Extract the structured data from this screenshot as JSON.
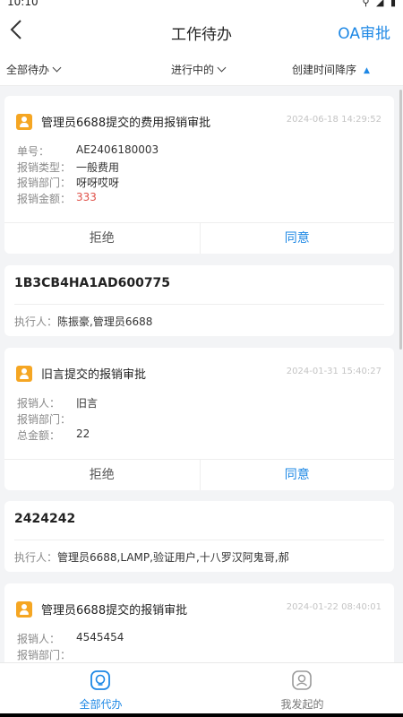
{
  "status_bar": {
    "time": "10:10"
  },
  "header": {
    "title": "工作待办",
    "action": "OA审批"
  },
  "filters": {
    "scope": "全部待办",
    "state": "进行中的",
    "sort": "创建时间降序"
  },
  "approvals": [
    {
      "title": "管理员6688提交的费用报销审批",
      "time": "2024-06-18 14:29:52",
      "fields": [
        {
          "label": "单号：",
          "value": "AE2406180003"
        },
        {
          "label": "报销类型：",
          "value": "一般费用"
        },
        {
          "label": "报销部门：",
          "value": "呀呀哎呀"
        },
        {
          "label": "报销金额：",
          "value": "333",
          "highlight": "#e0524a"
        }
      ],
      "reject_label": "拒绝",
      "approve_label": "同意"
    },
    {
      "title": "旧言提交的报销审批",
      "time": "2024-01-31 15:40:27",
      "fields": [
        {
          "label": "报销人：",
          "value": "旧言"
        },
        {
          "label": "报销部门：",
          "value": ""
        },
        {
          "label": "总金额：",
          "value": "22"
        }
      ],
      "reject_label": "拒绝",
      "approve_label": "同意"
    },
    {
      "title": "管理员6688提交的报销审批",
      "time": "2024-01-22 08:40:01",
      "fields": [
        {
          "label": "报销人：",
          "value": "4545454"
        },
        {
          "label": "报销部门：",
          "value": ""
        }
      ]
    }
  ],
  "tasks": [
    {
      "code": "1B3CB4HA1AD600775",
      "executor_label": "执行人：",
      "executors": "陈振豪,管理员6688"
    },
    {
      "code": "2424242",
      "executor_label": "执行人：",
      "executors": "管理员6688,LAMP,验证用户,十八罗汉阿鬼哥,郝"
    }
  ],
  "tabs": [
    {
      "label": "全部代办",
      "icon": "bulb-icon",
      "active": true
    },
    {
      "label": "我发起的",
      "icon": "user-icon",
      "active": false
    }
  ],
  "colors": {
    "accent": "#1e88e5",
    "badge": "#f5a623",
    "amount": "#e0524a"
  }
}
